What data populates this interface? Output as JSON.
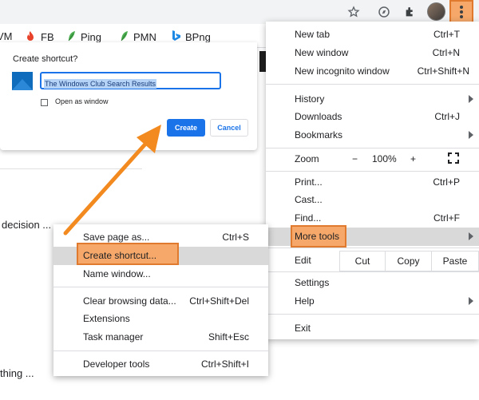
{
  "toolbar": {
    "star": "star-icon",
    "extensions": "puzzle-icon",
    "menu": "kebab-menu-icon"
  },
  "bookmarks": [
    {
      "label": "VM"
    },
    {
      "label": "FB"
    },
    {
      "label": "Ping"
    },
    {
      "label": "PMN"
    },
    {
      "label": "BPng"
    }
  ],
  "page": {
    "line1": "decision ...",
    "line2": "thing ..."
  },
  "dialog": {
    "title": "Create shortcut?",
    "name_value": "The Windows Club Search Results",
    "checkbox_label": "Open as window",
    "create": "Create",
    "cancel": "Cancel"
  },
  "menu": {
    "new_tab": {
      "label": "New tab",
      "shortcut": "Ctrl+T"
    },
    "new_window": {
      "label": "New window",
      "shortcut": "Ctrl+N"
    },
    "incognito": {
      "label": "New incognito window",
      "shortcut": "Ctrl+Shift+N"
    },
    "history": {
      "label": "History"
    },
    "downloads": {
      "label": "Downloads",
      "shortcut": "Ctrl+J"
    },
    "bookmarks": {
      "label": "Bookmarks"
    },
    "zoom": {
      "label": "Zoom",
      "minus": "−",
      "level": "100%",
      "plus": "+"
    },
    "print": {
      "label": "Print...",
      "shortcut": "Ctrl+P"
    },
    "cast": {
      "label": "Cast..."
    },
    "find": {
      "label": "Find...",
      "shortcut": "Ctrl+F"
    },
    "more_tools": {
      "label": "More tools"
    },
    "edit": {
      "label": "Edit",
      "cut": "Cut",
      "copy": "Copy",
      "paste": "Paste"
    },
    "settings": {
      "label": "Settings"
    },
    "help": {
      "label": "Help"
    },
    "exit": {
      "label": "Exit"
    }
  },
  "submenu": {
    "save_page": {
      "label": "Save page as...",
      "shortcut": "Ctrl+S"
    },
    "create_shortcut": {
      "label": "Create shortcut..."
    },
    "name_window": {
      "label": "Name window..."
    },
    "clear_data": {
      "label": "Clear browsing data...",
      "shortcut": "Ctrl+Shift+Del"
    },
    "extensions": {
      "label": "Extensions"
    },
    "task_manager": {
      "label": "Task manager",
      "shortcut": "Shift+Esc"
    },
    "dev_tools": {
      "label": "Developer tools",
      "shortcut": "Ctrl+Shift+I"
    }
  },
  "colors": {
    "accent": "#1a73e8",
    "highlight": "#f5a86a",
    "highlight_border": "#e07a2e",
    "arrow": "#f28a20"
  }
}
